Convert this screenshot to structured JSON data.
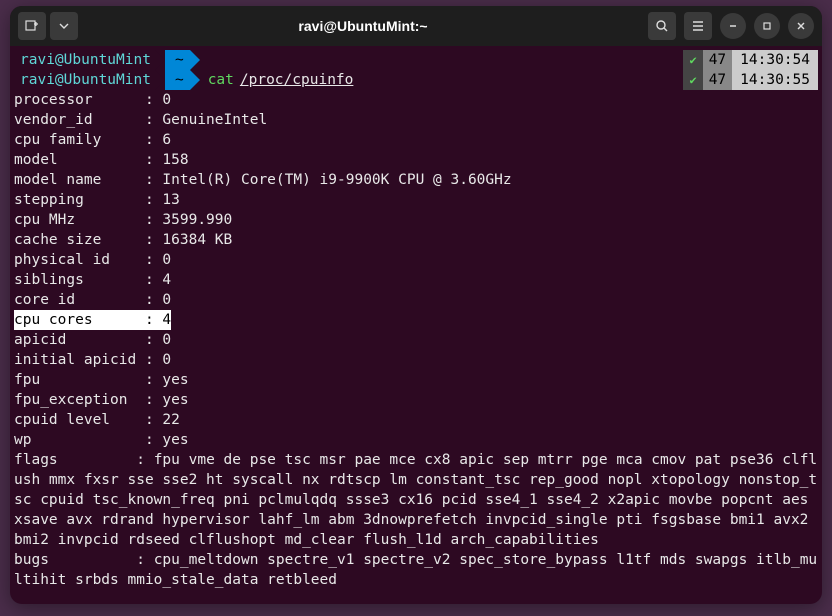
{
  "titlebar": {
    "title": "ravi@UbuntuMint:~"
  },
  "prompts": [
    {
      "user": "ravi@UbuntuMint",
      "path": "~",
      "cmd": "",
      "arg": "",
      "check": "✔",
      "badge": "47",
      "time": "14:30:54"
    },
    {
      "user": "ravi@UbuntuMint",
      "path": "~",
      "cmd": "cat",
      "arg": "/proc/cpuinfo",
      "check": "✔",
      "badge": "47",
      "time": "14:30:55"
    }
  ],
  "fields": [
    {
      "k": "processor",
      "v": "0"
    },
    {
      "k": "vendor_id",
      "v": "GenuineIntel"
    },
    {
      "k": "cpu family",
      "v": "6"
    },
    {
      "k": "model",
      "v": "158"
    },
    {
      "k": "model name",
      "v": "Intel(R) Core(TM) i9-9900K CPU @ 3.60GHz"
    },
    {
      "k": "stepping",
      "v": "13"
    },
    {
      "k": "cpu MHz",
      "v": "3599.990"
    },
    {
      "k": "cache size",
      "v": "16384 KB"
    },
    {
      "k": "physical id",
      "v": "0"
    },
    {
      "k": "siblings",
      "v": "4"
    },
    {
      "k": "core id",
      "v": "0"
    },
    {
      "k": "cpu cores",
      "v": "4",
      "highlight": true
    },
    {
      "k": "apicid",
      "v": "0"
    },
    {
      "k": "initial apicid",
      "v": "0"
    },
    {
      "k": "fpu",
      "v": "yes"
    },
    {
      "k": "fpu_exception",
      "v": "yes"
    },
    {
      "k": "cpuid level",
      "v": "22"
    },
    {
      "k": "wp",
      "v": "yes"
    }
  ],
  "flags_label": "flags",
  "flags_value": "fpu vme de pse tsc msr pae mce cx8 apic sep mtrr pge mca cmov pat pse36 clflush mmx fxsr sse sse2 ht syscall nx rdtscp lm constant_tsc rep_good nopl xtopology nonstop_tsc cpuid tsc_known_freq pni pclmulqdq ssse3 cx16 pcid sse4_1 sse4_2 x2apic movbe popcnt aes xsave avx rdrand hypervisor lahf_lm abm 3dnowprefetch invpcid_single pti fsgsbase bmi1 avx2 bmi2 invpcid rdseed clflushopt md_clear flush_l1d arch_capabilities",
  "bugs_label": "bugs",
  "bugs_value": "cpu_meltdown spectre_v1 spectre_v2 spec_store_bypass l1tf mds swapgs itlb_multihit srbds mmio_stale_data retbleed"
}
